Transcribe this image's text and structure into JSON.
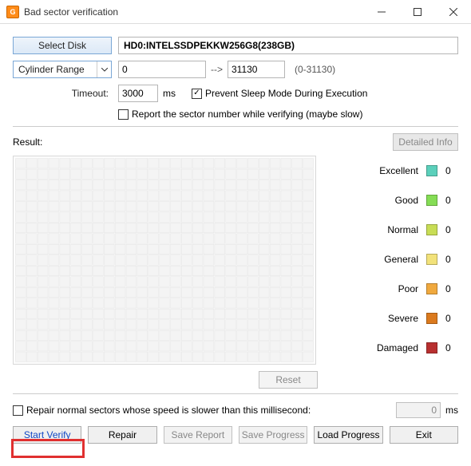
{
  "window": {
    "title": "Bad sector verification",
    "minimize": "–",
    "maximize": "▢",
    "close": "✕"
  },
  "disk": {
    "select_btn": "Select Disk",
    "selected": "HD0:INTELSSDPEKKW256G8(238GB)"
  },
  "range": {
    "mode": "Cylinder Range",
    "start": "0",
    "arrow": "-->",
    "end": "31130",
    "hint": "(0-31130)"
  },
  "timeout": {
    "label": "Timeout:",
    "value": "3000",
    "unit": "ms"
  },
  "options": {
    "prevent_sleep": "Prevent Sleep Mode During Execution",
    "report_sector": "Report the sector number while verifying (maybe slow)"
  },
  "result": {
    "label": "Result:",
    "detailed_btn": "Detailed Info",
    "reset_btn": "Reset"
  },
  "legend": [
    {
      "label": "Excellent",
      "color": "#5bd0bb",
      "count": "0"
    },
    {
      "label": "Good",
      "color": "#85dd55",
      "count": "0"
    },
    {
      "label": "Normal",
      "color": "#c8dd55",
      "count": "0"
    },
    {
      "label": "General",
      "color": "#f2e27a",
      "count": "0"
    },
    {
      "label": "Poor",
      "color": "#f0a93e",
      "count": "0"
    },
    {
      "label": "Severe",
      "color": "#db7a1e",
      "count": "0"
    },
    {
      "label": "Damaged",
      "color": "#b83030",
      "count": "0"
    }
  ],
  "repair": {
    "checkbox_label": "Repair normal sectors whose speed is slower than this millisecond:",
    "value": "0",
    "unit": "ms"
  },
  "buttons": {
    "start": "Start Verify",
    "repair": "Repair",
    "save_report": "Save Report",
    "save_progress": "Save Progress",
    "load_progress": "Load Progress",
    "exit": "Exit"
  }
}
